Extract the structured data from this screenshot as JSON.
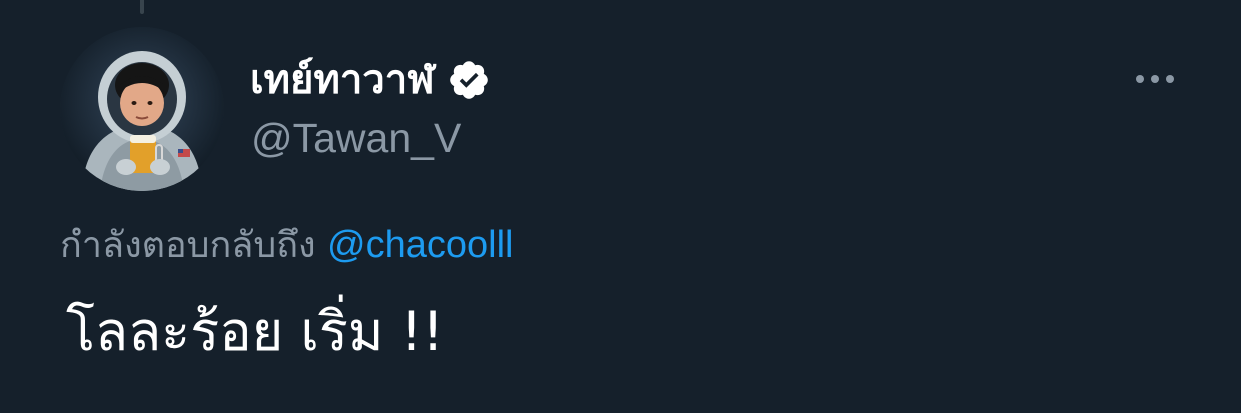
{
  "tweet": {
    "author": {
      "display_name": "เทย์ทาวาฬ",
      "handle": "@Tawan_V",
      "verified": true
    },
    "reply_context": {
      "prefix": "กำลังตอบกลับถึง",
      "mention": "@chacoolll"
    },
    "text": "โลละร้อย เริ่ม !!"
  },
  "icons": {
    "verified": "verified-badge-icon",
    "more": "more-options-icon"
  },
  "colors": {
    "background": "#15202b",
    "primary_text": "#ffffff",
    "secondary_text": "#8b98a5",
    "link": "#1d9bf0",
    "thread_line": "#38444d"
  }
}
